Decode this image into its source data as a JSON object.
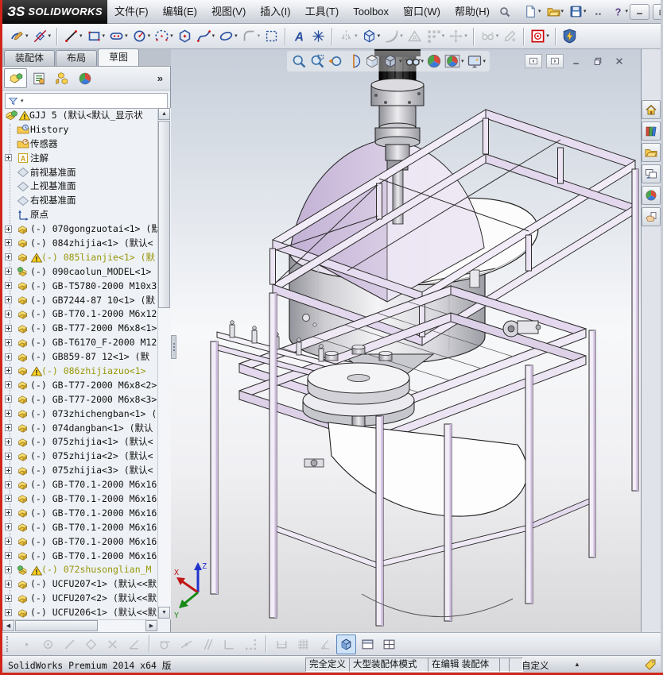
{
  "window": {
    "logo_mark": "ЗS",
    "logo_text": "SOLIDWORKS",
    "controls": [
      "minimize",
      "restore",
      "close"
    ]
  },
  "menu": {
    "items": [
      "文件(F)",
      "编辑(E)",
      "视图(V)",
      "插入(I)",
      "工具(T)",
      "Toolbox",
      "窗口(W)",
      "帮助(H)"
    ]
  },
  "quickbar": {
    "buttons": [
      {
        "icon": "doc-new",
        "dd": true
      },
      {
        "icon": "folder-open",
        "dd": true
      },
      {
        "icon": "save",
        "dd": true
      },
      {
        "icon": "dots",
        "dd": false
      },
      {
        "icon": "help",
        "dd": true
      }
    ]
  },
  "sketch_toolbar": {
    "buttons": [
      {
        "icon": "pencil-sketch",
        "dd": true
      },
      {
        "icon": "smart-dimension",
        "dd": true
      },
      {
        "sep": true
      },
      {
        "icon": "sk-line",
        "dd": true
      },
      {
        "icon": "sk-rect",
        "dd": true
      },
      {
        "icon": "sk-slot",
        "dd": true
      },
      {
        "icon": "sk-circle",
        "dd": true
      },
      {
        "icon": "sk-arc",
        "dd": true
      },
      {
        "icon": "sk-polygon"
      },
      {
        "icon": "sk-spline",
        "dd": true
      },
      {
        "icon": "sk-ellipse",
        "dd": true
      },
      {
        "icon": "sk-fillet",
        "dd": true,
        "dis": true
      },
      {
        "icon": "sk-trim"
      },
      {
        "sep": true
      },
      {
        "icon": "sk-text"
      },
      {
        "icon": "sk-point"
      },
      {
        "sep": true
      },
      {
        "icon": "sk-mirror",
        "dd": true,
        "dis": true
      },
      {
        "icon": "sk-convert",
        "dd": true
      },
      {
        "icon": "sk-offset",
        "dd": true,
        "dis": true
      },
      {
        "icon": "sk-warn",
        "dis": true
      },
      {
        "icon": "sk-pattern",
        "dd": true,
        "dis": true
      },
      {
        "icon": "sk-move",
        "dd": true,
        "dis": true
      },
      {
        "sep": true
      },
      {
        "icon": "sk-relations",
        "dd": true,
        "dis": true
      },
      {
        "icon": "sk-repair",
        "dis": true
      },
      {
        "sep": true
      },
      {
        "icon": "quick-snaps",
        "dd": true
      },
      {
        "sep": true
      },
      {
        "icon": "sketch-settings"
      }
    ]
  },
  "command_tabs": {
    "tabs": [
      {
        "label": "装配体",
        "active": false
      },
      {
        "label": "布局",
        "active": false
      },
      {
        "label": "草图",
        "active": true
      }
    ]
  },
  "feature_panel": {
    "toolbar": {
      "icons": [
        "featuremanager",
        "propertymanager",
        "configmanager",
        "displaymanager"
      ],
      "overflow_label": "»"
    },
    "filter": {
      "icon": "funnel"
    },
    "tree": [
      {
        "icon": "assembly-root",
        "badge": true,
        "label": "GJJ 5 (默认<默认_显示状",
        "root": true
      },
      {
        "icon": "folder-history",
        "label": "History"
      },
      {
        "icon": "folder-sensor",
        "label": "传感器"
      },
      {
        "icon": "annotation",
        "label": "注解",
        "expander": true
      },
      {
        "icon": "plane",
        "label": "前视基准面"
      },
      {
        "icon": "plane",
        "label": "上视基准面"
      },
      {
        "icon": "plane",
        "label": "右视基准面"
      },
      {
        "icon": "origin",
        "label": "原点"
      },
      {
        "icon": "part",
        "label": "(-) 070gongzuotai<1> (默",
        "expander": true
      },
      {
        "icon": "part",
        "label": "(-) 084zhijia<1> (默认<",
        "expander": true
      },
      {
        "icon": "part",
        "label": "(-) 085lianjie<1> (默",
        "expander": true,
        "badge": true,
        "olive": true
      },
      {
        "icon": "subassembly",
        "label": "(-) 090caolun_MODEL<1>",
        "expander": true
      },
      {
        "icon": "part",
        "label": "(-) GB-T5780-2000 M10x3",
        "expander": true
      },
      {
        "icon": "part",
        "label": "(-) GB7244-87 10<1> (默",
        "expander": true
      },
      {
        "icon": "part",
        "label": "(-) GB-T70.1-2000 M6x12",
        "expander": true
      },
      {
        "icon": "part",
        "label": "(-) GB-T77-2000 M6x8<1>",
        "expander": true
      },
      {
        "icon": "part",
        "label": "(-) GB-T6170_F-2000 M12",
        "expander": true
      },
      {
        "icon": "part",
        "label": "(-) GB859-87 12<1> (默",
        "expander": true
      },
      {
        "icon": "part",
        "label": "(-) 086zhijiazuo<1>",
        "expander": true,
        "badge": true,
        "olive": true
      },
      {
        "icon": "part",
        "label": "(-) GB-T77-2000 M6x8<2>",
        "expander": true
      },
      {
        "icon": "part",
        "label": "(-) GB-T77-2000 M6x8<3>",
        "expander": true
      },
      {
        "icon": "part",
        "label": "(-) 073zhichengban<1> (",
        "expander": true
      },
      {
        "icon": "part",
        "label": "(-) 074dangban<1> (默认",
        "expander": true
      },
      {
        "icon": "part",
        "label": "(-) 075zhijia<1> (默认<",
        "expander": true
      },
      {
        "icon": "part",
        "label": "(-) 075zhijia<2> (默认<",
        "expander": true
      },
      {
        "icon": "part",
        "label": "(-) 075zhijia<3> (默认<",
        "expander": true
      },
      {
        "icon": "part",
        "label": "(-) GB-T70.1-2000 M6x16",
        "expander": true
      },
      {
        "icon": "part",
        "label": "(-) GB-T70.1-2000 M6x16",
        "expander": true
      },
      {
        "icon": "part",
        "label": "(-) GB-T70.1-2000 M6x16",
        "expander": true
      },
      {
        "icon": "part",
        "label": "(-) GB-T70.1-2000 M6x16",
        "expander": true
      },
      {
        "icon": "part",
        "label": "(-) GB-T70.1-2000 M6x16",
        "expander": true
      },
      {
        "icon": "part",
        "label": "(-) GB-T70.1-2000 M6x16",
        "expander": true
      },
      {
        "icon": "subassembly",
        "label": "(-) 072shusonglian_M",
        "expander": true,
        "badge": true,
        "olive": true
      },
      {
        "icon": "part",
        "label": "(-) UCFU207<1> (默认<<默",
        "expander": true
      },
      {
        "icon": "part",
        "label": "(-) UCFU207<2> (默认<<默",
        "expander": true
      },
      {
        "icon": "part",
        "label": "(-) UCFU206<1> (默认<<默",
        "expander": true
      }
    ]
  },
  "viewport": {
    "headsup": [
      {
        "icon": "zoom-fit"
      },
      {
        "icon": "zoom-area"
      },
      {
        "icon": "prev-view"
      },
      {
        "icon": "section-view"
      },
      {
        "icon": "view-orientation"
      },
      {
        "icon": "display-style",
        "dd": true
      },
      {
        "icon": "hide-show",
        "dd": true
      },
      {
        "icon": "edit-appearance"
      },
      {
        "icon": "apply-scene",
        "dd": true
      },
      {
        "icon": "view-settings",
        "dd": true
      }
    ],
    "doc_controls": [
      "pane-left",
      "pane-right",
      "doc-min",
      "doc-restore",
      "doc-close"
    ],
    "triad": {
      "x": "X",
      "y": "Y",
      "z": "Z"
    }
  },
  "task_pane": {
    "icons": [
      "home",
      "design-library",
      "file-explorer",
      "view-palette",
      "appearances",
      "custom-properties"
    ]
  },
  "snap_toolbar": {
    "buttons": [
      {
        "icon": "sn-point",
        "dis": true
      },
      {
        "icon": "sn-center",
        "dis": true
      },
      {
        "icon": "sn-line",
        "dis": true
      },
      {
        "icon": "sn-quad",
        "dis": true
      },
      {
        "icon": "sn-x",
        "dis": true
      },
      {
        "icon": "sn-angle",
        "dis": true
      },
      {
        "sep": true
      },
      {
        "icon": "sn-tangent",
        "dis": true
      },
      {
        "icon": "sn-mid",
        "dis": true
      },
      {
        "icon": "sn-parallel",
        "dis": true
      },
      {
        "icon": "sn-perp",
        "dis": true
      },
      {
        "icon": "sn-dots",
        "dis": true
      },
      {
        "sep": true
      },
      {
        "icon": "sn-hsnap",
        "dis": true
      },
      {
        "icon": "sn-grid",
        "dis": true
      },
      {
        "icon": "sn-angle2",
        "dis": true
      },
      {
        "icon": "cube3d",
        "pressed": true
      },
      {
        "icon": "pane-h"
      },
      {
        "icon": "pane-grid"
      }
    ]
  },
  "status_bar": {
    "left": "SolidWorks Premium 2014 x64 版",
    "cells": [
      "完全定义",
      "大型装配体模式",
      "在编辑 装配体",
      "",
      ""
    ],
    "custom": "自定义",
    "arrow": "▲"
  }
}
